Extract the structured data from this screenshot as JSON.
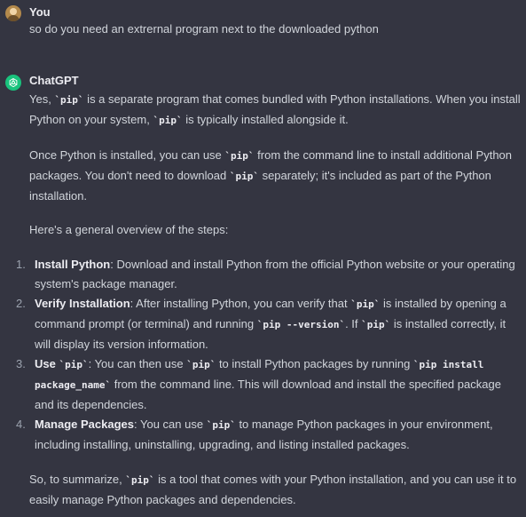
{
  "user_message": {
    "author": "You",
    "text": "so do you need an extrernal program next to the downloaded python"
  },
  "assistant_message": {
    "author": "ChatGPT",
    "p1": {
      "a": "Yes, ",
      "code1": "`pip`",
      "b": " is a separate program that comes bundled with Python installations. When you install Python on your system, ",
      "code2": "`pip`",
      "c": " is typically installed alongside it."
    },
    "p2": {
      "a": "Once Python is installed, you can use ",
      "code1": "`pip`",
      "b": " from the command line to install additional Python packages. You don't need to download ",
      "code2": "`pip`",
      "c": " separately; it's included as part of the Python installation."
    },
    "p3": "Here's a general overview of the steps:",
    "steps": [
      {
        "num": "1.",
        "title": "Install Python",
        "text": ": Download and install Python from the official Python website or your operating system's package manager."
      },
      {
        "num": "2.",
        "title": "Verify Installation",
        "a": ": After installing Python, you can verify that ",
        "code1": "`pip`",
        "b": " is installed by opening a command prompt (or terminal) and running ",
        "code2": "`pip --version`",
        "c": ". If ",
        "code3": "`pip`",
        "d": " is installed correctly, it will display its version information."
      },
      {
        "num": "3.",
        "title": "Use ",
        "title_code": "`pip`",
        "a": ": You can then use ",
        "code1": "`pip`",
        "b": " to install Python packages by running ",
        "code2": "`pip install package_name`",
        "c": " from the command line. This will download and install the specified package and its dependencies."
      },
      {
        "num": "4.",
        "title": "Manage Packages",
        "a": ": You can use ",
        "code1": "`pip`",
        "b": " to manage Python packages in your environment, including installing, uninstalling, upgrading, and listing installed packages."
      }
    ],
    "p4": {
      "a": "So, to summarize, ",
      "code1": "`pip`",
      "b": " is a tool that comes with your Python installation, and you can use it to easily manage Python packages and dependencies."
    }
  },
  "icons": {
    "user_avatar": "user-avatar-icon",
    "assistant_avatar": "openai-logo-icon"
  },
  "colors": {
    "background": "#343541",
    "text": "#d1d5db",
    "heading": "#ececf1",
    "gpt_avatar": "#19c37d"
  }
}
